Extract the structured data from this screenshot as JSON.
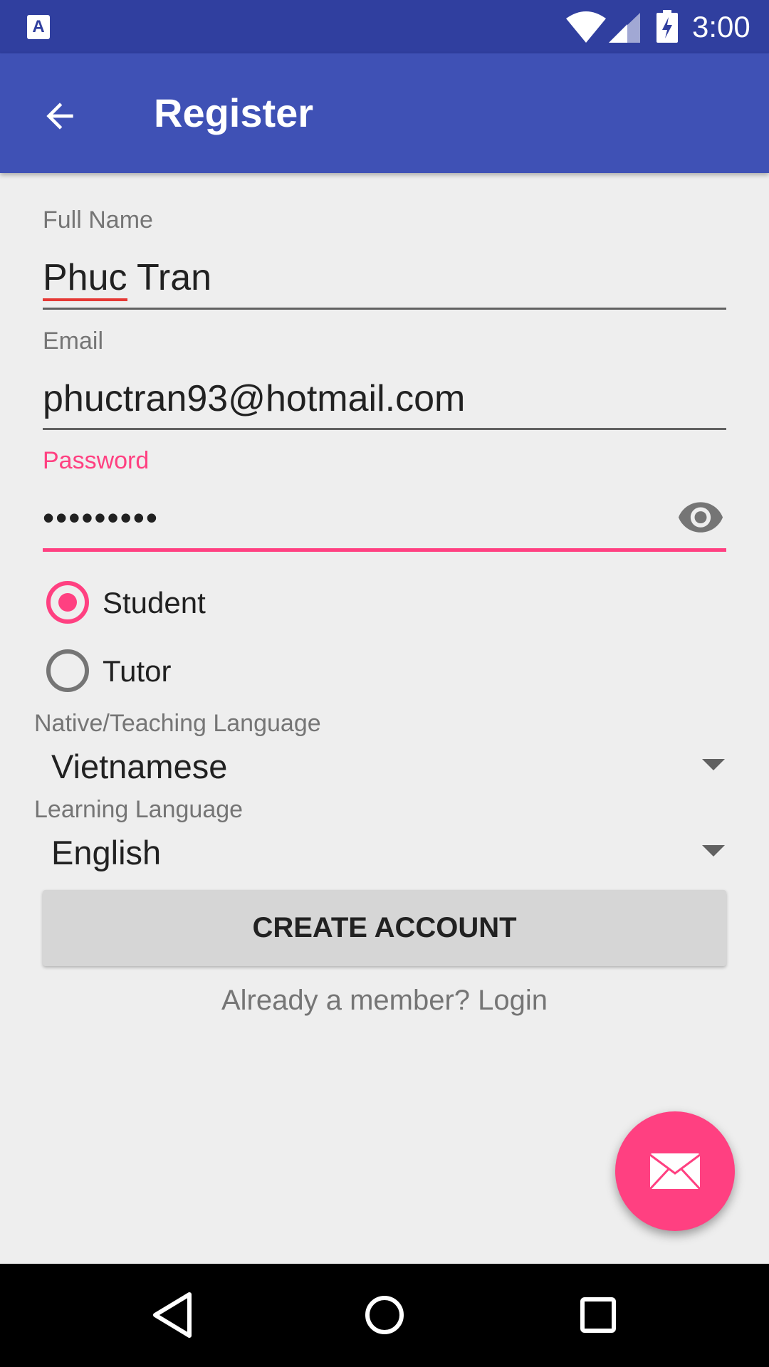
{
  "status_bar": {
    "time": "3:00",
    "notification_icon": "a-keyboard-icon",
    "notification_letter": "A"
  },
  "app_bar": {
    "title": "Register",
    "back_icon": "arrow-back-icon"
  },
  "form": {
    "full_name": {
      "label": "Full Name",
      "value_first": "Phuc",
      "value_rest": " Tran"
    },
    "email": {
      "label": "Email",
      "value": "phuctran93@hotmail.com"
    },
    "password": {
      "label": "Password",
      "value": "•••••••••",
      "toggle_icon": "eye-icon"
    },
    "role": {
      "options": [
        {
          "label": "Student",
          "checked": true
        },
        {
          "label": "Tutor",
          "checked": false
        }
      ]
    },
    "native_language": {
      "label": "Native/Teaching Language",
      "value": "Vietnamese"
    },
    "learning_language": {
      "label": "Learning Language",
      "value": "English"
    }
  },
  "actions": {
    "create_account": "CREATE ACCOUNT",
    "login_link": "Already a member? Login"
  },
  "fab": {
    "icon": "mail-icon"
  },
  "colors": {
    "primary": "#3f51b5",
    "primary_dark": "#303f9f",
    "accent": "#ff4081"
  }
}
